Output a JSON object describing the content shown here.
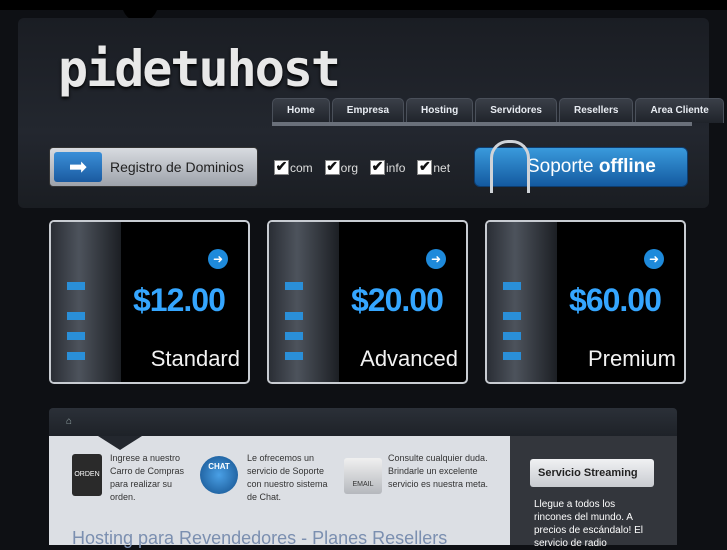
{
  "logo": "pidetuhost",
  "nav": [
    "Home",
    "Empresa",
    "Hosting",
    "Servidores",
    "Resellers",
    "Area Cliente"
  ],
  "domain": {
    "label": "Registro de Dominios",
    "tlds": [
      "com",
      "org",
      "info",
      "net"
    ]
  },
  "support": {
    "label": "Soporte",
    "status": "offline"
  },
  "plans": [
    {
      "price": "$12.00",
      "name": "Standard"
    },
    {
      "price": "$20.00",
      "name": "Advanced"
    },
    {
      "price": "$60.00",
      "name": "Premium"
    }
  ],
  "features": [
    {
      "text": "Ingrese a nuestro Carro de Compras para realizar su orden.",
      "icon": "orden",
      "icon_name": "shopping-bag-icon"
    },
    {
      "text": "Le ofrecemos un servicio de Soporte con nuestro sistema de Chat.",
      "icon": "CHAT",
      "icon_name": "chat-globe-icon"
    },
    {
      "text": "Consulte cualquier duda. Brindarle un excelente servicio es nuestra meta.",
      "icon": "EMAIL",
      "icon_name": "email-icon"
    }
  ],
  "content_title": "Hosting para Revendedores - Planes Resellers",
  "sidebar": {
    "title": "Servicio Streaming",
    "text": "Llegue a todos los rincones del mundo. A precios de escándalo! El servicio de radio"
  },
  "colors": {
    "accent": "#35a6ff",
    "support": "#1a6fbf"
  }
}
